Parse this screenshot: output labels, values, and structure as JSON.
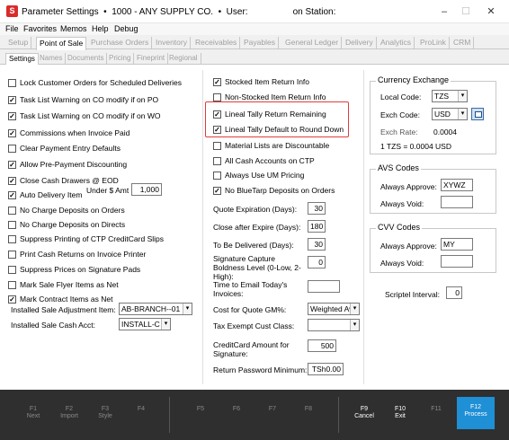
{
  "window": {
    "title": "Parameter Settings  •  1000 - ANY SUPPLY CO.  •  User:                  on Station:",
    "icon_letter": "S",
    "minimize": "–",
    "maximize": "☐",
    "close": "✕"
  },
  "menu": [
    "File",
    "Favorites",
    "Memos",
    "Help",
    "Debug"
  ],
  "main_tabs": [
    "Setup",
    "Point of Sale",
    "Purchase Orders",
    "Inventory",
    "Receivables",
    "Payables",
    "General Ledger",
    "Delivery",
    "Analytics",
    "ProLink",
    "CRM"
  ],
  "sub_tabs": [
    "Settings",
    "Names",
    "Documents",
    "Pricing",
    "Fineprint",
    "Regional"
  ],
  "left_checks": [
    {
      "label": "Lock Customer Orders for Scheduled Deliveries",
      "checked": false
    },
    {
      "label": "Task List Warning on CO modify if on PO",
      "checked": true
    },
    {
      "label": "Task List Warning on CO modify if on WO",
      "checked": true
    },
    {
      "label": "Commissions when Invoice Paid",
      "checked": true
    },
    {
      "label": "Clear Payment Entry Defaults",
      "checked": false
    },
    {
      "label": "Allow Pre-Payment Discounting",
      "checked": true
    },
    {
      "label": "Close Cash Drawers @ EOD",
      "checked": true
    },
    {
      "label": "Auto Delivery Item",
      "checked": true
    },
    {
      "label": "No Charge Deposits on Orders",
      "checked": false
    },
    {
      "label": "No Charge Deposits on Directs",
      "checked": false
    },
    {
      "label": "Suppress Printing of CTP CreditCard Slips",
      "checked": false
    },
    {
      "label": "Print Cash Returns on Invoice Printer",
      "checked": false
    },
    {
      "label": "Suppress Prices on Signature Pads",
      "checked": false
    },
    {
      "label": "Mark Sale Flyer Items as Net",
      "checked": false
    },
    {
      "label": "Mark Contract Items as Net",
      "checked": true
    }
  ],
  "under_amt": {
    "label": "Under $ Amt",
    "value": "1,000"
  },
  "installed_sale_adjustment": {
    "label": "Installed Sale Adjustment Item:",
    "value": "AB-BRANCH--01"
  },
  "installed_sale_cash": {
    "label": "Installed Sale Cash Acct:",
    "value": "INSTALL-C"
  },
  "mid_checks": [
    {
      "label": "Stocked Item Return Info",
      "checked": true
    },
    {
      "label": "Non-Stocked Item Return Info",
      "checked": false
    },
    {
      "label": "Lineal Tally Return Remaining",
      "checked": true
    },
    {
      "label": "Lineal Tally Default to Round Down",
      "checked": true
    },
    {
      "label": "Material Lists are Discountable",
      "checked": false
    },
    {
      "label": "All Cash Accounts on CTP",
      "checked": false
    },
    {
      "label": "Always Use UM Pricing",
      "checked": false
    },
    {
      "label": "No BlueTarp Deposits on Orders",
      "checked": true
    }
  ],
  "mid_fields": [
    {
      "label": "Quote Expiration (Days):",
      "value": "30"
    },
    {
      "label": "Close after Expire (Days):",
      "value": "180"
    },
    {
      "label": "To Be Delivered (Days):",
      "value": "30"
    },
    {
      "label": "Signature Capture Boldness Level (0-Low, 2-High):",
      "value": "0"
    },
    {
      "label": "Time to Email Today's Invoices:",
      "value": ""
    },
    {
      "label": "Cost for Quote GM%:",
      "value": "Weighted Av"
    },
    {
      "label": "Tax Exempt Cust Class:",
      "value": ""
    },
    {
      "label": "CreditCard Amount for Signature:",
      "value": "500"
    },
    {
      "label": "Return Password Minimum:",
      "value": "TSh0.00"
    }
  ],
  "currency": {
    "title": "Currency Exchange",
    "local_code_label": "Local Code:",
    "local_code": "TZS",
    "exch_code_label": "Exch Code:",
    "exch_code": "USD",
    "exch_rate_label": "Exch Rate:",
    "exch_rate": "0.0004",
    "summary": "1 TZS = 0.0004 USD"
  },
  "avs": {
    "title": "AVS Codes",
    "always_approve_label": "Always Approve:",
    "always_approve": "XYWZ",
    "always_void_label": "Always Void:",
    "always_void": ""
  },
  "cvv": {
    "title": "CVV Codes",
    "always_approve_label": "Always Approve:",
    "always_approve": "MY",
    "always_void_label": "Always Void:",
    "always_void": ""
  },
  "scriptel": {
    "label": "Scriptel Interval:",
    "value": "0"
  },
  "fkeys": [
    {
      "key": "F1",
      "name": "Next"
    },
    {
      "key": "F2",
      "name": "Import"
    },
    {
      "key": "F3",
      "name": "Style"
    },
    {
      "key": "F4",
      "name": ""
    },
    {
      "key": "F5",
      "name": ""
    },
    {
      "key": "F6",
      "name": ""
    },
    {
      "key": "F7",
      "name": ""
    },
    {
      "key": "F8",
      "name": ""
    },
    {
      "key": "F9",
      "name": "Cancel"
    },
    {
      "key": "F10",
      "name": "Exit"
    },
    {
      "key": "F11",
      "name": ""
    },
    {
      "key": "F12",
      "name": "Process"
    }
  ],
  "colors": {
    "highlight": "#e23b3b",
    "primary": "#1f8fd6",
    "footer": "#2f2f2f"
  }
}
